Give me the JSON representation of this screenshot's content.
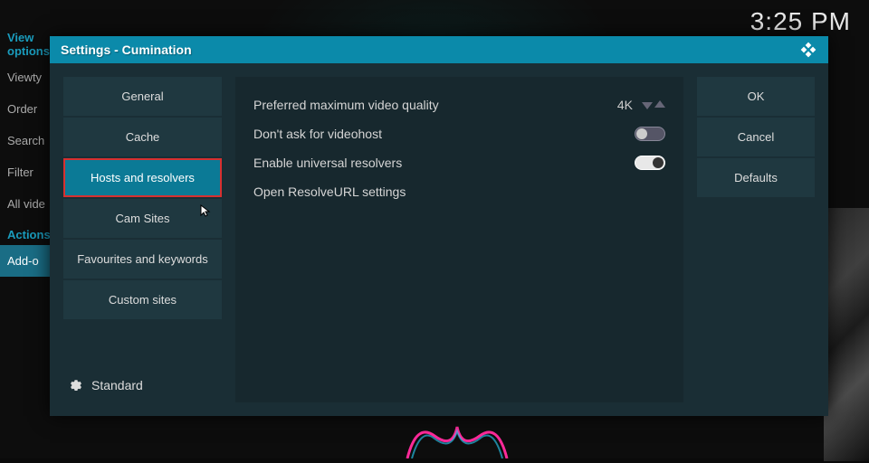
{
  "clock": "3:25 PM",
  "leftPanel": {
    "header1": "View options",
    "items1": [
      "Viewty",
      "Order",
      "Search",
      "Filter",
      "All vide"
    ],
    "header2": "Actions",
    "items2": [
      "Add-o"
    ]
  },
  "dialog": {
    "title": "Settings - Cumination",
    "categories": [
      "General",
      "Cache",
      "Hosts and resolvers",
      "Cam Sites",
      "Favourites and keywords",
      "Custom sites"
    ],
    "activeCategory": 2,
    "level": "Standard",
    "settings": [
      {
        "label": "Preferred maximum video quality",
        "type": "spinner",
        "value": "4K"
      },
      {
        "label": "Don't ask for videohost",
        "type": "toggle",
        "value": false
      },
      {
        "label": "Enable universal resolvers",
        "type": "toggle",
        "value": true
      },
      {
        "label": "Open ResolveURL settings",
        "type": "action"
      }
    ],
    "actions": {
      "ok": "OK",
      "cancel": "Cancel",
      "defaults": "Defaults"
    }
  }
}
